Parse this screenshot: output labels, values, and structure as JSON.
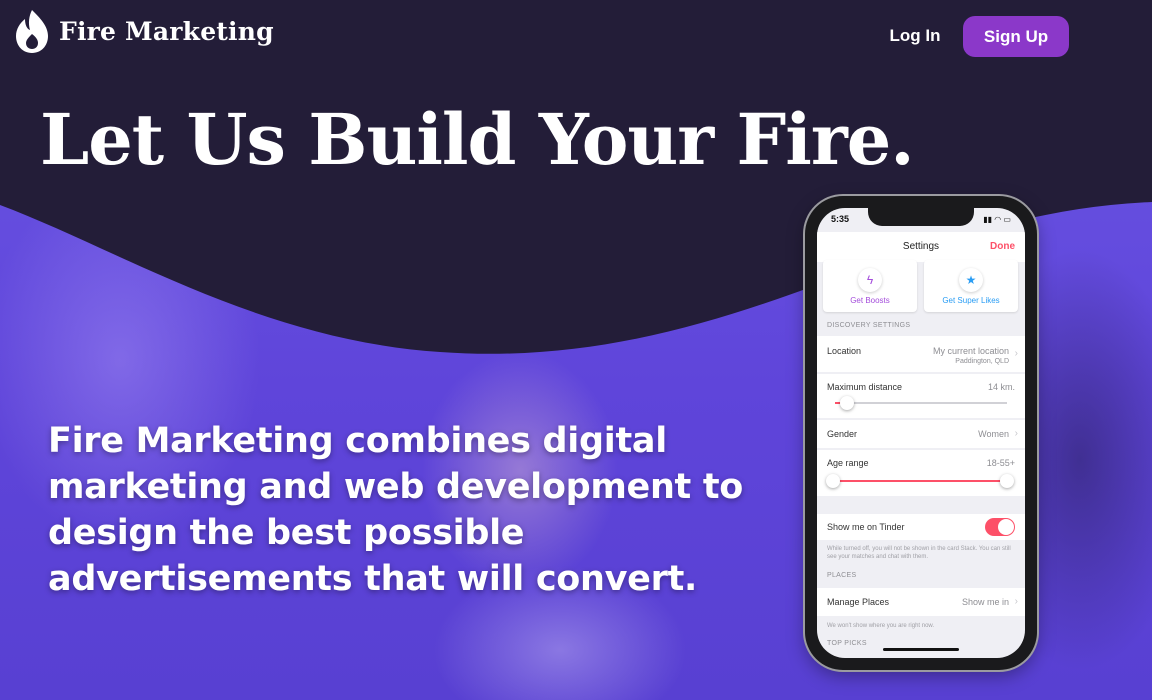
{
  "brand": {
    "name": "Fire Marketing",
    "logo_icon": "flame-icon"
  },
  "nav": {
    "login_label": "Log In",
    "signup_label": "Sign Up"
  },
  "hero": {
    "headline": "Let Us Build Your Fire.",
    "tagline": "Fire Marketing combines digital marketing and web development to design the best possible advertisements that will convert."
  },
  "colors": {
    "signup_bg": "#8b38c9",
    "header_dark": "#231d38",
    "hero_purple": "#5f45da",
    "accent": "#fd5068"
  },
  "phone": {
    "time": "5:35",
    "title": "Settings",
    "done_label": "Done",
    "tiles": [
      {
        "label": "Get Boosts",
        "icon": "lightning-icon"
      },
      {
        "label": "Get Super Likes",
        "icon": "star-icon"
      }
    ],
    "discovery_head": "DISCOVERY SETTINGS",
    "location_label": "Location",
    "location_value": "My current location",
    "location_sub": "Paddington, QLD",
    "distance_label": "Maximum distance",
    "distance_value": "14 km.",
    "gender_label": "Gender",
    "gender_value": "Women",
    "age_label": "Age range",
    "age_value": "18-55+",
    "show_me_label": "Show me on Tinder",
    "show_me_note": "While turned off, you will not be shown in the card Stack. You can still see your matches and chat with them.",
    "places_head": "PLACES",
    "manage_places_label": "Manage Places",
    "manage_places_value": "Show me in",
    "places_note": "We won't show where you are right now.",
    "top_picks_head": "TOP PICKS"
  }
}
